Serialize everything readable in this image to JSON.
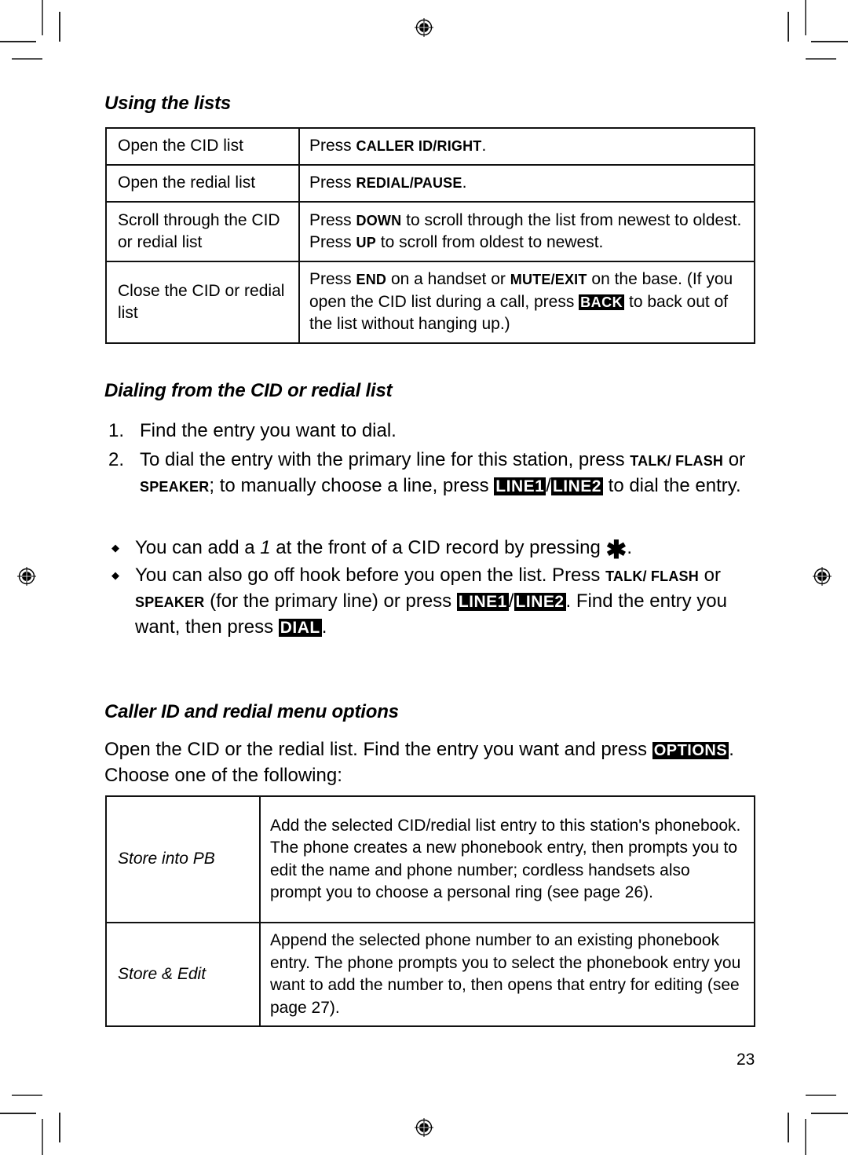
{
  "sections": {
    "using_lists": {
      "title": "Using the lists",
      "rows": [
        {
          "key": "Open the CID list",
          "pre": "Press ",
          "bold": "CALLER ID/RIGHT",
          "post": "."
        },
        {
          "key": "Open the redial list",
          "pre": "Press ",
          "bold": "REDIAL/PAUSE",
          "post": "."
        },
        {
          "key": "Scroll through the CID or redial list",
          "pre": "Press ",
          "bold": "DOWN",
          "mid": " to scroll through the list from newest to oldest. Press ",
          "bold2": "UP",
          "post": " to scroll from oldest to newest."
        },
        {
          "key": "Close the CID or redial list",
          "pre": "Press ",
          "bold": "END",
          "mid": " on a handset or ",
          "bold2": "MUTE/EXIT",
          "mid2": " on the base. (If you open the CID list during a call, press ",
          "softkey": "BACK",
          "post": " to back out of the list without hanging up.)"
        }
      ]
    },
    "dialing": {
      "title": "Dialing from the CID or redial list",
      "steps": [
        {
          "num": "1.",
          "text": "Find the entry you want to dial."
        },
        {
          "num": "2.",
          "pre": "To dial the entry with the primary line for this station, press ",
          "bold": "TALK/ FLASH",
          "mid": " or ",
          "bold2": "SPEAKER",
          "mid2": "; to manually choose a line, press ",
          "softkey1": "LINE1",
          "sep": "/",
          "softkey2": "LINE2",
          "post": " to dial the entry."
        }
      ],
      "bullets": [
        {
          "pre": "You can add a ",
          "italic": "1",
          "mid": " at the front of a CID record by pressing ",
          "symbol": "✱",
          "post": "."
        },
        {
          "pre": "You can also go off hook before you open the list. Press ",
          "bold": "TALK/ FLASH",
          "mid": " or ",
          "bold2": "SPEAKER",
          "mid2": " (for the primary line) or press ",
          "softkey1": "LINE1",
          "sep": "/",
          "softkey2": "LINE2",
          "mid3": ". Find the entry you want, then press ",
          "softkey3": "DIAL",
          "post": "."
        }
      ]
    },
    "menu_options": {
      "title": "Caller ID and redial menu options",
      "intro_pre": "Open the CID or the redial list. Find the entry you want and press ",
      "intro_softkey": "OPTIONS",
      "intro_post": ". Choose one of the following:",
      "rows": [
        {
          "key": "Store into PB",
          "desc": "Add the selected CID/redial list entry to this station's phonebook. The phone creates a new phonebook entry, then prompts you to edit the name and phone number; cordless handsets also prompt you to choose a personal ring (see page 26)."
        },
        {
          "key": "Store & Edit",
          "desc": "Append the selected phone number to an existing phonebook entry. The phone prompts you to select the phonebook entry you want to add the number to, then opens that entry for editing (see page 27)."
        }
      ]
    }
  },
  "page_number": "23",
  "icons": {
    "registration_mark": "registration-target",
    "bullet": "diamond"
  }
}
